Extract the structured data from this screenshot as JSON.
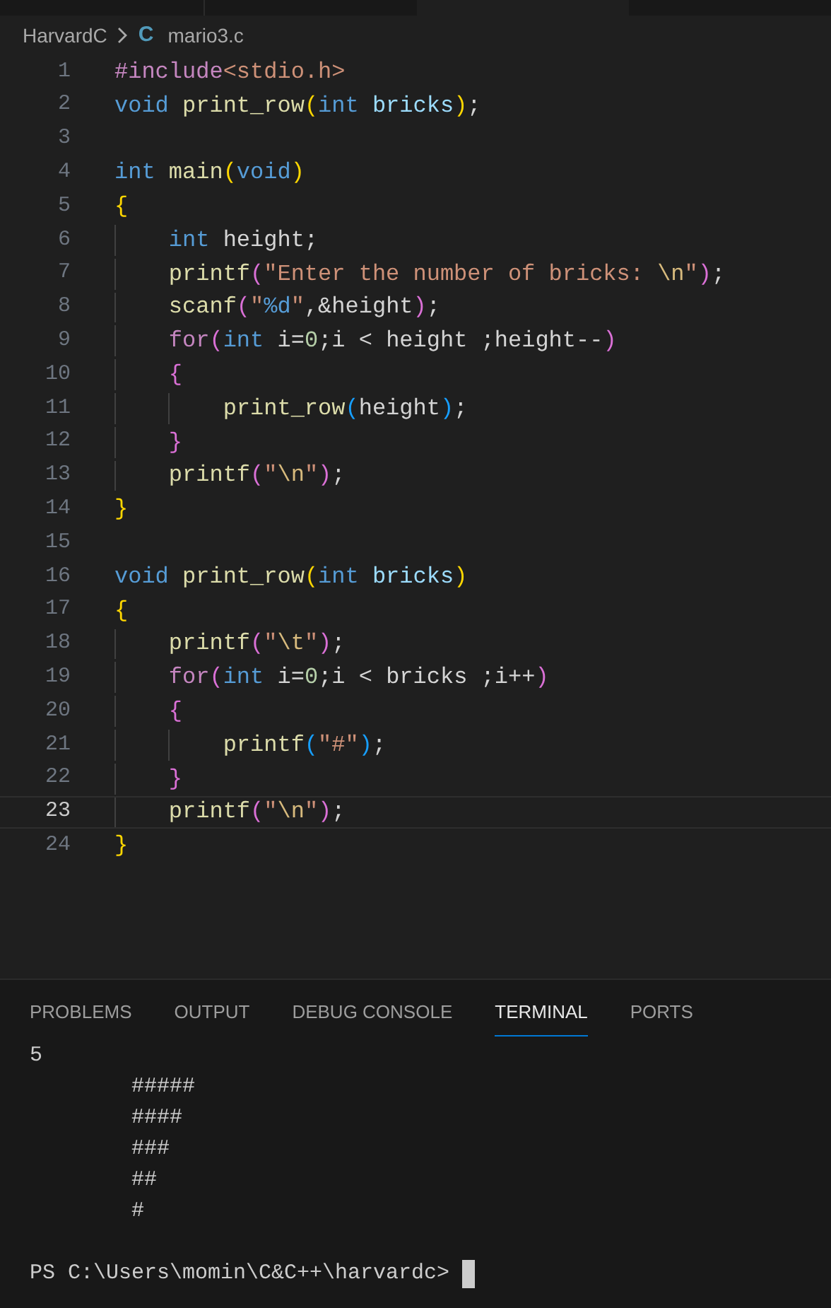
{
  "breadcrumb": {
    "folder": "HarvardC",
    "file_icon": "C",
    "file": "mario3.c"
  },
  "editor": {
    "lines": [
      {
        "number": "1",
        "current": false,
        "tokens": [
          {
            "text": "#include",
            "kind": "preproc"
          },
          {
            "text": "<stdio.h>",
            "kind": "string"
          }
        ]
      },
      {
        "number": "2",
        "current": false,
        "tokens": [
          {
            "text": "void ",
            "kind": "keyword"
          },
          {
            "text": "print_row",
            "kind": "func"
          },
          {
            "text": "(",
            "kind": "bracket1"
          },
          {
            "text": "int ",
            "kind": "keyword"
          },
          {
            "text": "bricks",
            "kind": "param"
          },
          {
            "text": ")",
            "kind": "bracket1"
          },
          {
            "text": ";",
            "kind": "plain"
          }
        ]
      },
      {
        "number": "3",
        "current": false
      },
      {
        "number": "4",
        "current": false,
        "tokens": [
          {
            "text": "int ",
            "kind": "keyword"
          },
          {
            "text": "main",
            "kind": "func"
          },
          {
            "text": "(",
            "kind": "bracket1"
          },
          {
            "text": "void",
            "kind": "keyword"
          },
          {
            "text": ")",
            "kind": "bracket1"
          }
        ]
      },
      {
        "number": "5",
        "current": false,
        "tokens": [
          {
            "text": "{",
            "kind": "bracket1"
          }
        ]
      },
      {
        "number": "6",
        "current": false,
        "tokens": [
          {
            "text": "    int",
            "kind": "keyword"
          },
          {
            "text": " height;",
            "kind": "plain"
          }
        ]
      },
      {
        "number": "7",
        "current": false,
        "tokens": [
          {
            "text": "    printf",
            "kind": "func"
          },
          {
            "text": "(",
            "kind": "bracket2"
          },
          {
            "text": "\"Enter the number of bricks: ",
            "kind": "string"
          },
          {
            "text": "\\n",
            "kind": "escape"
          },
          {
            "text": "\"",
            "kind": "string"
          },
          {
            "text": ")",
            "kind": "bracket2"
          },
          {
            "text": ";",
            "kind": "plain"
          }
        ]
      },
      {
        "number": "8",
        "current": false,
        "tokens": [
          {
            "text": "    scanf",
            "kind": "func"
          },
          {
            "text": "(",
            "kind": "bracket2"
          },
          {
            "text": "\"",
            "kind": "string"
          },
          {
            "text": "%d",
            "kind": "keyword"
          },
          {
            "text": "\"",
            "kind": "string"
          },
          {
            "text": ",&height",
            "kind": "plain"
          },
          {
            "text": ")",
            "kind": "bracket2"
          },
          {
            "text": ";",
            "kind": "plain"
          }
        ]
      },
      {
        "number": "9",
        "current": false,
        "tokens": [
          {
            "text": "    for",
            "kind": "control"
          },
          {
            "text": "(",
            "kind": "bracket2"
          },
          {
            "text": "int",
            "kind": "keyword"
          },
          {
            "text": " i=",
            "kind": "plain"
          },
          {
            "text": "0",
            "kind": "number"
          },
          {
            "text": ";i < height ;height--",
            "kind": "plain"
          },
          {
            "text": ")",
            "kind": "bracket2"
          }
        ]
      },
      {
        "number": "10",
        "current": false,
        "tokens": [
          {
            "text": "    {",
            "kind": "bracket2"
          }
        ]
      },
      {
        "number": "11",
        "current": false,
        "tokens": [
          {
            "text": "        print_row",
            "kind": "func"
          },
          {
            "text": "(",
            "kind": "bracket3"
          },
          {
            "text": "height",
            "kind": "plain"
          },
          {
            "text": ")",
            "kind": "bracket3"
          },
          {
            "text": ";",
            "kind": "plain"
          }
        ]
      },
      {
        "number": "12",
        "current": false,
        "tokens": [
          {
            "text": "    }",
            "kind": "bracket2"
          }
        ]
      },
      {
        "number": "13",
        "current": false,
        "tokens": [
          {
            "text": "    printf",
            "kind": "func"
          },
          {
            "text": "(",
            "kind": "bracket2"
          },
          {
            "text": "\"",
            "kind": "string"
          },
          {
            "text": "\\n",
            "kind": "escape"
          },
          {
            "text": "\"",
            "kind": "string"
          },
          {
            "text": ")",
            "kind": "bracket2"
          },
          {
            "text": ";",
            "kind": "plain"
          }
        ]
      },
      {
        "number": "14",
        "current": false,
        "tokens": [
          {
            "text": "}",
            "kind": "bracket1"
          }
        ]
      },
      {
        "number": "15",
        "current": false
      },
      {
        "number": "16",
        "current": false,
        "tokens": [
          {
            "text": "void ",
            "kind": "keyword"
          },
          {
            "text": "print_row",
            "kind": "func"
          },
          {
            "text": "(",
            "kind": "bracket1"
          },
          {
            "text": "int ",
            "kind": "keyword"
          },
          {
            "text": "bricks",
            "kind": "param"
          },
          {
            "text": ")",
            "kind": "bracket1"
          }
        ]
      },
      {
        "number": "17",
        "current": false,
        "tokens": [
          {
            "text": "{",
            "kind": "bracket1"
          }
        ]
      },
      {
        "number": "18",
        "current": false,
        "tokens": [
          {
            "text": "    printf",
            "kind": "func"
          },
          {
            "text": "(",
            "kind": "bracket2"
          },
          {
            "text": "\"",
            "kind": "string"
          },
          {
            "text": "\\t",
            "kind": "escape"
          },
          {
            "text": "\"",
            "kind": "string"
          },
          {
            "text": ")",
            "kind": "bracket2"
          },
          {
            "text": ";",
            "kind": "plain"
          }
        ]
      },
      {
        "number": "19",
        "current": false,
        "tokens": [
          {
            "text": "    for",
            "kind": "control"
          },
          {
            "text": "(",
            "kind": "bracket2"
          },
          {
            "text": "int",
            "kind": "keyword"
          },
          {
            "text": " i=",
            "kind": "plain"
          },
          {
            "text": "0",
            "kind": "number"
          },
          {
            "text": ";i < bricks ;i++",
            "kind": "plain"
          },
          {
            "text": ")",
            "kind": "bracket2"
          }
        ]
      },
      {
        "number": "20",
        "current": false,
        "tokens": [
          {
            "text": "    {",
            "kind": "bracket2"
          }
        ]
      },
      {
        "number": "21",
        "current": false,
        "tokens": [
          {
            "text": "        printf",
            "kind": "func"
          },
          {
            "text": "(",
            "kind": "bracket3"
          },
          {
            "text": "\"#\"",
            "kind": "string"
          },
          {
            "text": ")",
            "kind": "bracket3"
          },
          {
            "text": ";",
            "kind": "plain"
          }
        ]
      },
      {
        "number": "22",
        "current": false,
        "tokens": [
          {
            "text": "    }",
            "kind": "bracket2"
          }
        ]
      },
      {
        "number": "23",
        "current": true,
        "tokens": [
          {
            "text": "    printf",
            "kind": "func"
          },
          {
            "text": "(",
            "kind": "bracket2"
          },
          {
            "text": "\"",
            "kind": "string"
          },
          {
            "text": "\\n",
            "kind": "escape"
          },
          {
            "text": "\"",
            "kind": "string"
          },
          {
            "text": ")",
            "kind": "bracket2"
          },
          {
            "text": ";",
            "kind": "plain"
          }
        ]
      },
      {
        "number": "24",
        "current": false,
        "tokens": [
          {
            "text": "}",
            "kind": "bracket1"
          }
        ]
      }
    ]
  },
  "panel": {
    "tabs": [
      {
        "label": "PROBLEMS",
        "selected": false
      },
      {
        "label": "OUTPUT",
        "selected": false
      },
      {
        "label": "DEBUG CONSOLE",
        "selected": false
      },
      {
        "label": "TERMINAL",
        "selected": true
      },
      {
        "label": "PORTS",
        "selected": false
      }
    ],
    "terminal": {
      "output": [
        "5",
        "\t#####",
        "\t####",
        "\t###",
        "\t##",
        "\t#"
      ],
      "prompt": "PS C:\\Users\\momin\\C&C++\\harvardc>"
    }
  }
}
